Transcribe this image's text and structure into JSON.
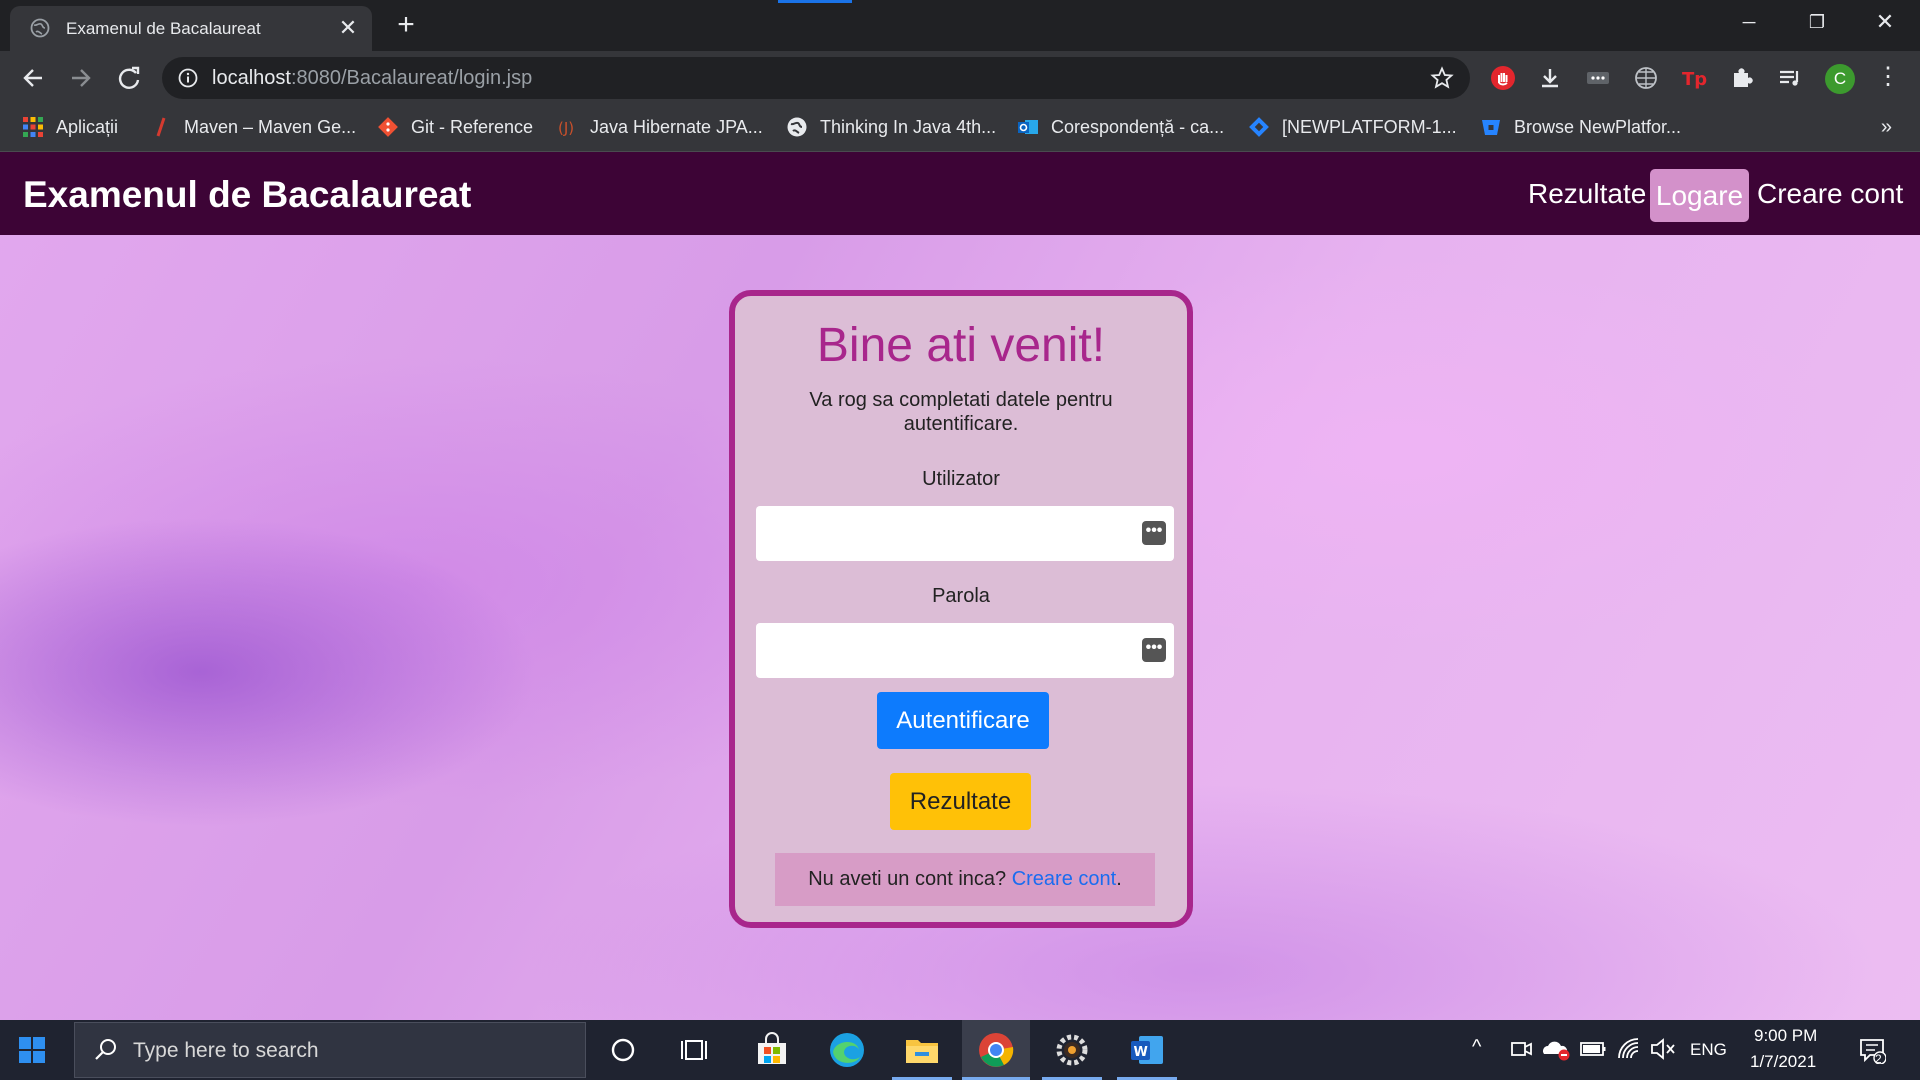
{
  "browser": {
    "tab_title": "Examenul de Bacalaureat",
    "url_host": "localhost",
    "url_rest": ":8080/Bacalaureat/login.jsp",
    "bookmarks": [
      {
        "label": "Aplicații",
        "icon": "apps-grid-icon"
      },
      {
        "label": "Maven – Maven Ge...",
        "icon": "maven-icon"
      },
      {
        "label": "Git - Reference",
        "icon": "git-icon"
      },
      {
        "label": "Java Hibernate JPA...",
        "icon": "java-icon"
      },
      {
        "label": "Thinking In Java 4th...",
        "icon": "globe-icon"
      },
      {
        "label": "Corespondență - ca...",
        "icon": "outlook-icon"
      },
      {
        "label": "[NEWPLATFORM-1...",
        "icon": "jira-icon"
      },
      {
        "label": "Browse NewPlatfor...",
        "icon": "bitbucket-icon"
      }
    ],
    "profile_initial": "C"
  },
  "site": {
    "brand": "Examenul de Bacalaureat",
    "nav": {
      "results": "Rezultate",
      "login": "Logare",
      "signup": "Creare cont"
    }
  },
  "login_card": {
    "title": "Bine ati venit!",
    "subtitle": "Va rog sa completati datele pentru autentificare.",
    "username_label": "Utilizator",
    "username_value": "",
    "password_label": "Parola",
    "password_value": "",
    "login_button": "Autentificare",
    "results_button": "Rezultate",
    "signup_prompt": "Nu aveti un cont inca?",
    "signup_link": "Creare cont",
    "signup_suffix": "."
  },
  "colors": {
    "nav_bg": "#3d0436",
    "card_border": "#a8268c",
    "primary": "#0d7bfd",
    "warning": "#ffc107"
  },
  "taskbar": {
    "search_placeholder": "Type here to search",
    "language": "ENG",
    "time": "9:00 PM",
    "date": "1/7/2021",
    "notification_count": "2"
  }
}
